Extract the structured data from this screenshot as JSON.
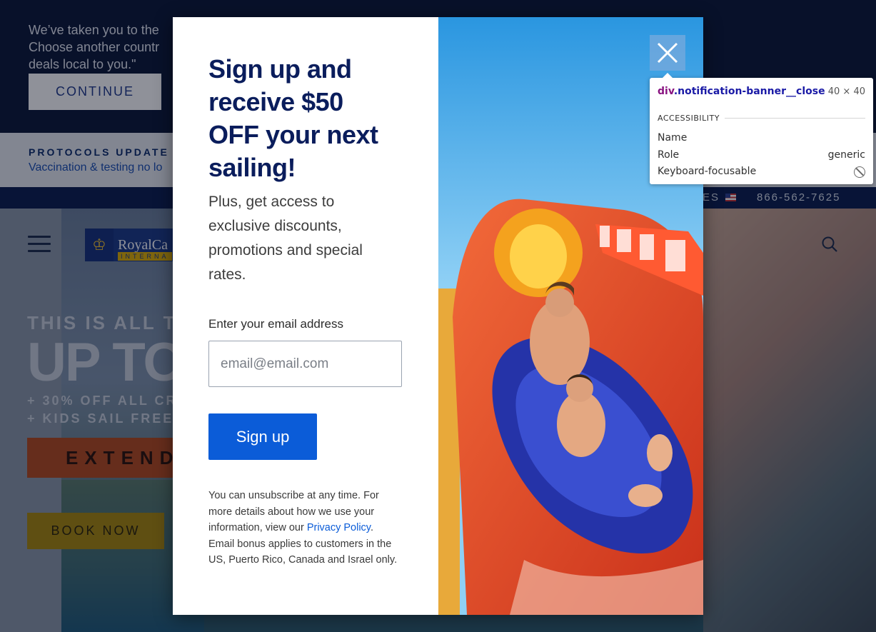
{
  "background": {
    "geo_banner": {
      "text": "We’ve taken you to the\nChoose another countr\ndeals local to you.\"",
      "continue_label": "CONTINUE"
    },
    "protocols": {
      "title": "PROTOCOLS UPDATE",
      "subtitle": "Vaccination & testing no lo"
    },
    "utility": {
      "suffix": "ES",
      "phone": "866-562-7625"
    },
    "logo": {
      "text": "RoyalCa",
      "subtext": "INTERNA"
    },
    "hero": {
      "headline_small": "THIS IS ALL TH",
      "headline_big": "UP TO $",
      "line1": "+ 30% OFF ALL CR",
      "line2": "+ KIDS SAIL FREE*",
      "extended_label": "EXTENDE",
      "book_now_label": "BOOK NOW"
    }
  },
  "modal": {
    "title": "Sign up and receive $50 OFF your next sailing!",
    "subtitle": "Plus, get access to exclusive discounts, promotions and special rates.",
    "email_label": "Enter your email address",
    "email_placeholder": "email@email.com",
    "signup_label": "Sign up",
    "disclaimer_before": "You can unsubscribe at any time. For more details about how we use your information, view our ",
    "privacy_link": "Privacy Policy",
    "disclaimer_after": ". Email bonus applies to customers in the US, Puerto Rico, Canada and Israel only."
  },
  "devtools_tooltip": {
    "tag": "div",
    "class_name": ".notification-banner__close",
    "size": "40 × 40",
    "section": "ACCESSIBILITY",
    "name_label": "Name",
    "role_label": "Role",
    "role_value": "generic",
    "focusable_label": "Keyboard-focusable",
    "focusable_icon": "no-entry-icon"
  },
  "colors": {
    "primary_blue": "#0b5cd8",
    "title_navy": "#0a1d5c",
    "banner_navy": "#0a1636"
  }
}
